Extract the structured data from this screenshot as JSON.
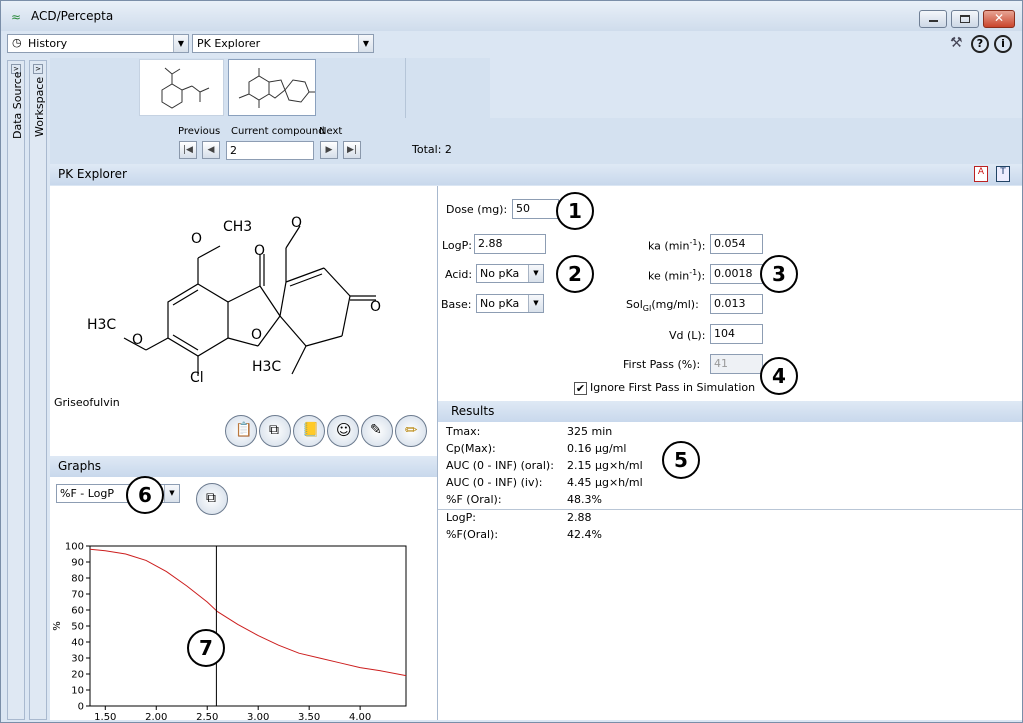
{
  "window": {
    "title": "ACD/Percepta"
  },
  "toolbar": {
    "history_label": "History",
    "module_label": "PK Explorer"
  },
  "side_tabs": {
    "data_source": "Data Source",
    "workspace": "Workspace"
  },
  "navigator": {
    "previous_label": "Previous",
    "current_label": "Current compound",
    "next_label": "Next",
    "current_value": "2",
    "total_label": "Total: 2"
  },
  "pk_explorer": {
    "header": "PK Explorer",
    "compound_name": "Griseofulvin",
    "dose_label": "Dose (mg):",
    "dose_value": "50",
    "logp_label": "LogP:",
    "logp_value": "2.88",
    "acid_label": "Acid:",
    "acid_value": "No pKa",
    "base_label": "Base:",
    "base_value": "No pKa",
    "ka_label": "ka (min",
    "ka_value": "0.054",
    "ke_label": "ke (min",
    "ke_value": "0.0018",
    "sol_label": "Sol",
    "sol_sub": "GI",
    "sol_unit": "(mg/ml):",
    "sol_value": "0.013",
    "vd_label": "Vd (L):",
    "vd_value": "104",
    "first_pass_label": "First Pass (%):",
    "first_pass_value": "41",
    "ignore_first_pass": "Ignore First Pass in Simulation",
    "exp_minus1": "-1",
    "close_paren": "):"
  },
  "results": {
    "header": "Results",
    "rows": [
      {
        "label": "Tmax:",
        "value": "325 min"
      },
      {
        "label": "Cp(Max):",
        "value": "0.16 μg/ml"
      },
      {
        "label": "AUC (0 - INF) (oral):",
        "value": "2.15 μg×h/ml"
      },
      {
        "label": "AUC (0 - INF) (iv):",
        "value": "4.45 μg×h/ml"
      },
      {
        "label": "%F (Oral):",
        "value": "48.3%"
      }
    ],
    "rows2": [
      {
        "label": "LogP:",
        "value": "2.88"
      },
      {
        "label": "%F(Oral):",
        "value": "42.4%"
      }
    ]
  },
  "graphs": {
    "header": "Graphs",
    "selector_value": "%F - LogP"
  },
  "callouts": [
    "1",
    "2",
    "3",
    "4",
    "5",
    "6",
    "7"
  ],
  "molecule": {
    "labels": [
      "O",
      "CH3",
      "O",
      "O",
      "O",
      "O",
      "O",
      "H3C",
      "O",
      "Cl",
      "H3C"
    ],
    "sub3": "3",
    "stereo_note": ""
  },
  "chart_data": {
    "type": "line",
    "xlabel": "",
    "ylabel": "%",
    "xlim": [
      1.35,
      4.45
    ],
    "ylim": [
      0,
      100
    ],
    "y_ticks": [
      "0",
      "10",
      "20",
      "30",
      "40",
      "50",
      "60",
      "70",
      "80",
      "90",
      "100"
    ],
    "x_ticks": [
      "1.50",
      "2.00",
      "2.50",
      "3.00",
      "3.50",
      "4.00"
    ],
    "marker_x": 2.59,
    "series": [
      {
        "x": [
          1.35,
          1.5,
          1.7,
          1.9,
          2.1,
          2.3,
          2.5,
          2.6,
          2.8,
          3.0,
          3.2,
          3.4,
          3.6,
          3.8,
          4.0,
          4.2,
          4.45
        ],
        "y": [
          98,
          97,
          95,
          91,
          84,
          75,
          65,
          59,
          51,
          44,
          38,
          33,
          30,
          27,
          24,
          22,
          19
        ],
        "color": "#cc1e1e"
      }
    ]
  }
}
